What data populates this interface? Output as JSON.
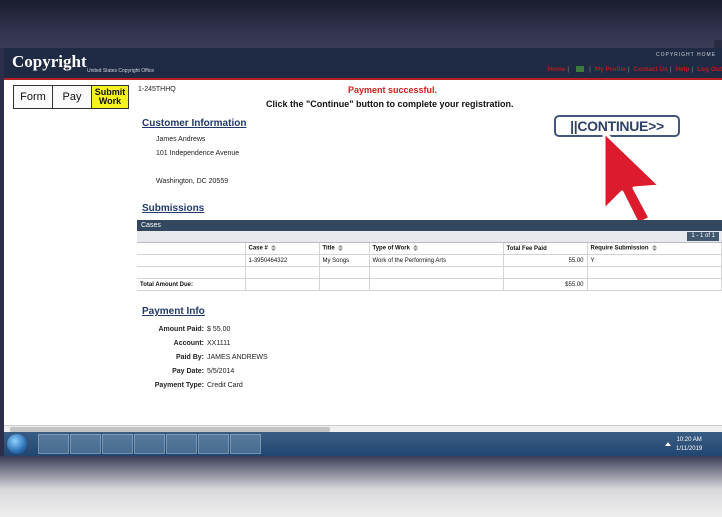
{
  "header": {
    "logo_text": "Copyright",
    "logo_sub": "United States Copyright Office",
    "home_label": "COPYRIGHT HOME",
    "links": [
      "Home",
      "My Profile",
      "Contact Us",
      "Help",
      "Log Out"
    ]
  },
  "steps": {
    "form": "Form",
    "pay": "Pay",
    "submit": "Submit Work"
  },
  "registration_number": "1-245THHQ",
  "status_message": "Payment successful.",
  "instruction": "Click the \"Continue\" button to complete your registration.",
  "continue_label": "||CONTINUE>>",
  "customer": {
    "title": "Customer Information",
    "name": "James Andrews",
    "address": "101 Independence Avenue",
    "city": "Washington, DC 20559"
  },
  "submissions": {
    "title": "Submissions",
    "bar_label": "Cases",
    "pager": "1 - 1 of 1",
    "columns": [
      "Case #",
      "Title",
      "Type of Work",
      "Total Fee Paid",
      "Require Submission"
    ],
    "rows": [
      {
        "case": "1-3950464322",
        "title": "My Songs",
        "type": "Work of the Performing Arts",
        "fee": "55.00",
        "require": "Y"
      }
    ],
    "total_label": "Total Amount Due:",
    "total_value": "$55.00"
  },
  "payment": {
    "title": "Payment Info",
    "amount_label": "Amount Paid:",
    "amount": "$  55.00",
    "account_label": "Account:",
    "account": "XX1111",
    "paidby_label": "Paid By:",
    "paidby": "JAMES ANDREWS",
    "date_label": "Pay Date:",
    "date": "5/5/2014",
    "type_label": "Payment Type:",
    "type": "Credit Card"
  },
  "taskbar": {
    "time": "10:20 AM",
    "date": "1/11/2019"
  },
  "colors": {
    "header": "#1f2a44",
    "accent_red": "#d21b1b",
    "step_active": "#f5f21e",
    "cases_bar": "#33485e"
  }
}
